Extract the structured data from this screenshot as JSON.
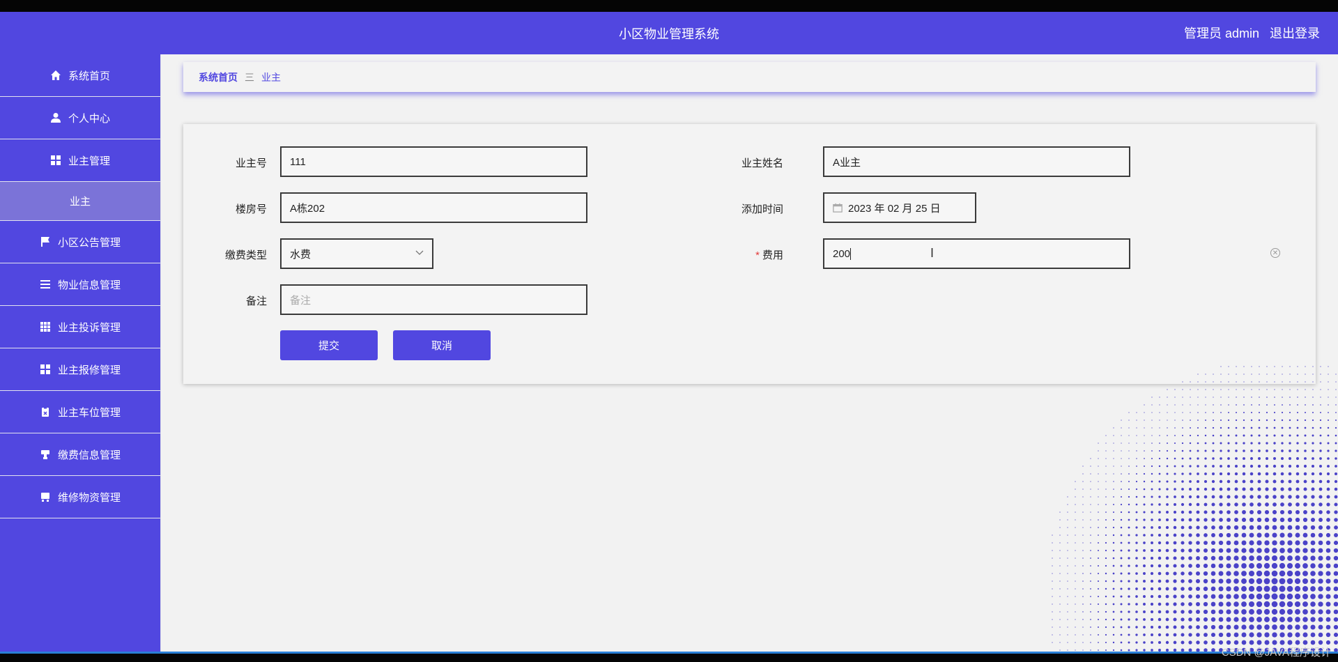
{
  "header": {
    "title": "小区物业管理系统",
    "role": "管理员 admin",
    "logout": "退出登录"
  },
  "sidebar": {
    "items": [
      {
        "label": "系统首页",
        "icon": "home-icon"
      },
      {
        "label": "个人中心",
        "icon": "user-icon"
      },
      {
        "label": "业主管理",
        "icon": "grid-icon"
      },
      {
        "label": "业主",
        "icon": ""
      },
      {
        "label": "小区公告管理",
        "icon": "flag-icon"
      },
      {
        "label": "物业信息管理",
        "icon": "list-icon"
      },
      {
        "label": "业主投诉管理",
        "icon": "table-icon"
      },
      {
        "label": "业主报修管理",
        "icon": "grid-icon"
      },
      {
        "label": "业主车位管理",
        "icon": "clipboard-icon"
      },
      {
        "label": "缴费信息管理",
        "icon": "stamp-icon"
      },
      {
        "label": "维修物资管理",
        "icon": "cabinet-icon"
      }
    ]
  },
  "breadcrumb": {
    "home": "系统首页",
    "separator": "三",
    "current": "业主"
  },
  "form": {
    "owner_no": {
      "label": "业主号",
      "value": "111"
    },
    "owner_name": {
      "label": "业主姓名",
      "value": "A业主"
    },
    "building_no": {
      "label": "楼房号",
      "value": "A栋202"
    },
    "add_time": {
      "label": "添加时间",
      "value": "2023 年 02 月 25 日"
    },
    "fee_type": {
      "label": "缴费类型",
      "value": "水费"
    },
    "fee": {
      "label": "费用",
      "required_mark": "*",
      "value": "200"
    },
    "remark": {
      "label": "备注",
      "placeholder": "备注"
    },
    "submit": "提交",
    "cancel": "取消"
  },
  "watermark": "CSDN @JAVA程序设计",
  "colors": {
    "accent": "#5147e0",
    "submenu": "#7b73d8",
    "background": "#f2f2f2"
  }
}
